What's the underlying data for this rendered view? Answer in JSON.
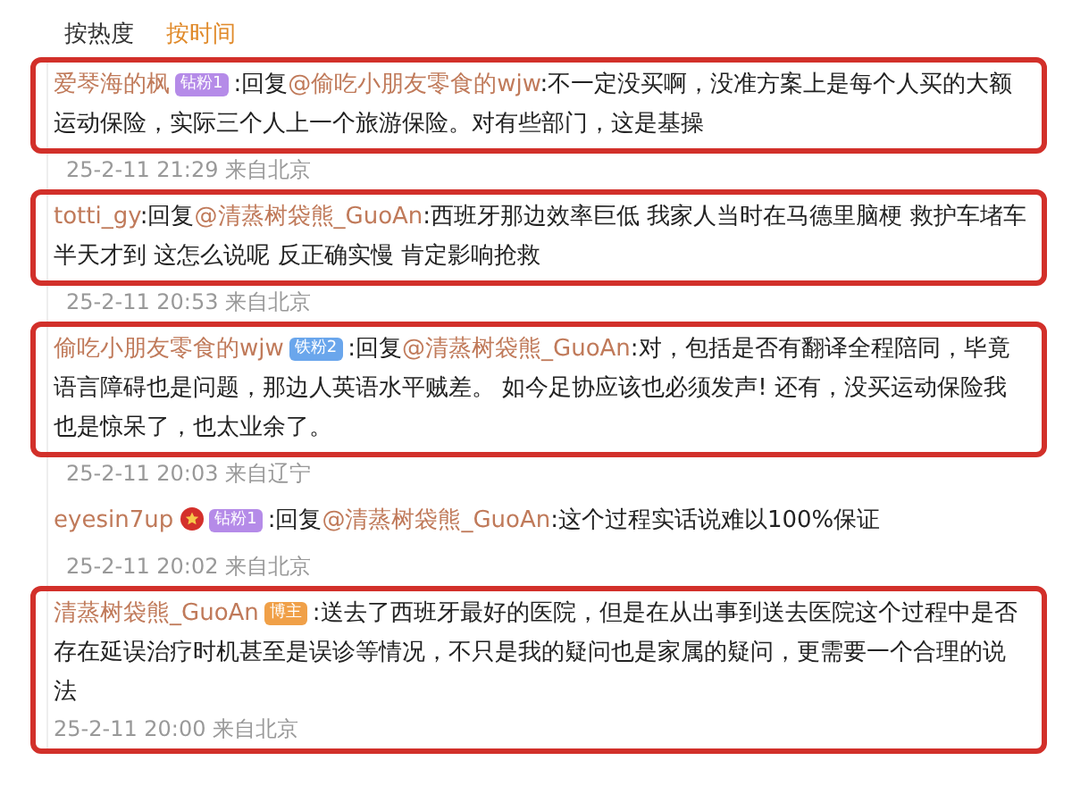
{
  "tabs": [
    {
      "label": "按热度",
      "selected": false
    },
    {
      "label": "按时间",
      "selected": true
    }
  ],
  "comments": [
    {
      "user": "爱琴海的枫",
      "badge": {
        "kind": "fan",
        "label": "钻粉1"
      },
      "verified": false,
      "reply_prefix": ":回复",
      "reply_to": "@偷吃小朋友零食的wjw",
      "text": ":不一定没买啊，没准方案上是每个人买的大额运动保险，实际三个人上一个旅游保险。对有些部门，这是基操",
      "time": "25-2-11 21:29 来自北京",
      "highlighted": true,
      "time_in_frame": false
    },
    {
      "user": "totti_gy",
      "verified": false,
      "reply_prefix": ":回复",
      "reply_to": "@清蒸树袋熊_GuoAn",
      "text": ":西班牙那边效率巨低 我家人当时在马德里脑梗 救护车堵车半天才到 这怎么说呢 反正确实慢 肯定影响抢救",
      "time": "25-2-11 20:53 来自北京",
      "highlighted": true,
      "time_in_frame": false
    },
    {
      "user": "偷吃小朋友零食的wjw",
      "badge": {
        "kind": "iron",
        "label": "铁粉2"
      },
      "verified": false,
      "reply_prefix": ":回复",
      "reply_to": "@清蒸树袋熊_GuoAn",
      "text": ":对，包括是否有翻译全程陪同，毕竟语言障碍也是问题，那边人英语水平贼差。 如今足协应该也必须发声! 还有，没买运动保险我也是惊呆了，也太业余了。",
      "time": "25-2-11 20:03 来自辽宁",
      "highlighted": true,
      "time_in_frame": false
    },
    {
      "user": "eyesin7up",
      "badge": {
        "kind": "fan",
        "label": "钻粉1"
      },
      "verified": true,
      "reply_prefix": ":回复",
      "reply_to": "@清蒸树袋熊_GuoAn",
      "text": ":这个过程实话说难以100%保证",
      "time": "25-2-11 20:02 来自北京",
      "highlighted": false
    },
    {
      "user": "清蒸树袋熊_GuoAn",
      "badge": {
        "kind": "author",
        "label": "博主"
      },
      "verified": false,
      "text": ":送去了西班牙最好的医院，但是在从出事到送去医院这个过程中是否存在延误治疗时机甚至是误诊等情况，不只是我的疑问也是家属的疑问，更需要一个合理的说法",
      "time": "25-2-11 20:00 来自北京",
      "highlighted": true,
      "time_in_frame": true
    }
  ]
}
